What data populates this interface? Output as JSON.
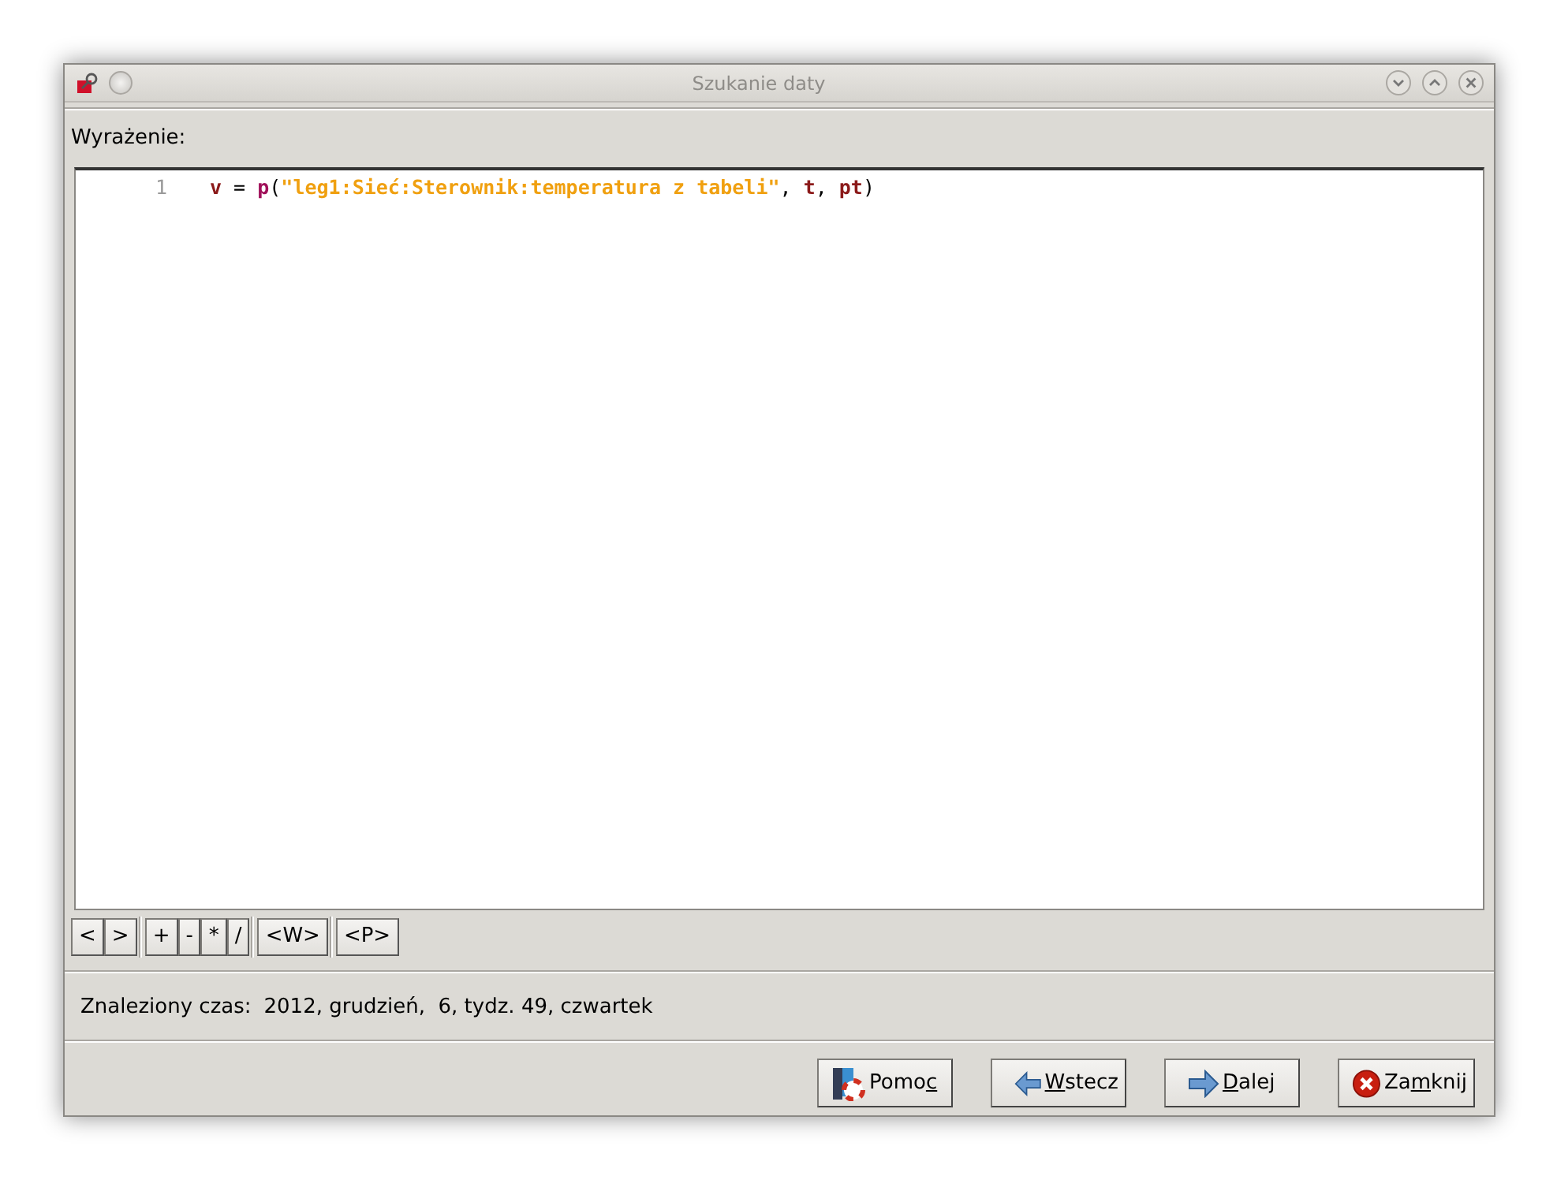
{
  "window": {
    "title": "Szukanie daty"
  },
  "expression_label": "Wyrażenie:",
  "editor": {
    "lines": [
      {
        "number": "1",
        "tokens": [
          {
            "kind": "identifier",
            "text": "v"
          },
          {
            "kind": "plain",
            "text": " = "
          },
          {
            "kind": "function",
            "text": "p"
          },
          {
            "kind": "plain",
            "text": "("
          },
          {
            "kind": "string",
            "text": "\"leg1:Sieć:Sterownik:temperatura z tabeli\""
          },
          {
            "kind": "plain",
            "text": ", "
          },
          {
            "kind": "identifier",
            "text": "t"
          },
          {
            "kind": "plain",
            "text": ", "
          },
          {
            "kind": "identifier",
            "text": "pt"
          },
          {
            "kind": "plain",
            "text": ")"
          }
        ]
      }
    ]
  },
  "insert_button_groups": [
    [
      {
        "label": "<"
      },
      {
        "label": ">"
      }
    ],
    [
      {
        "label": "+"
      },
      {
        "label": "-"
      },
      {
        "label": "*"
      },
      {
        "label": "/"
      }
    ],
    [
      {
        "label": "<W>"
      }
    ],
    [
      {
        "label": "<P>"
      }
    ]
  ],
  "result": {
    "label": "Znaleziony czas:",
    "value": "2012, grudzień,  6, tydz. 49, czwartek"
  },
  "buttons": [
    {
      "kind": "help",
      "before": "Pomo",
      "key": "c"
    },
    {
      "kind": "back",
      "key": "W",
      "after": "stecz"
    },
    {
      "kind": "next",
      "key": "D",
      "after": "alej"
    },
    {
      "kind": "close",
      "before": "Za",
      "key": "m",
      "after": "knij"
    }
  ]
}
